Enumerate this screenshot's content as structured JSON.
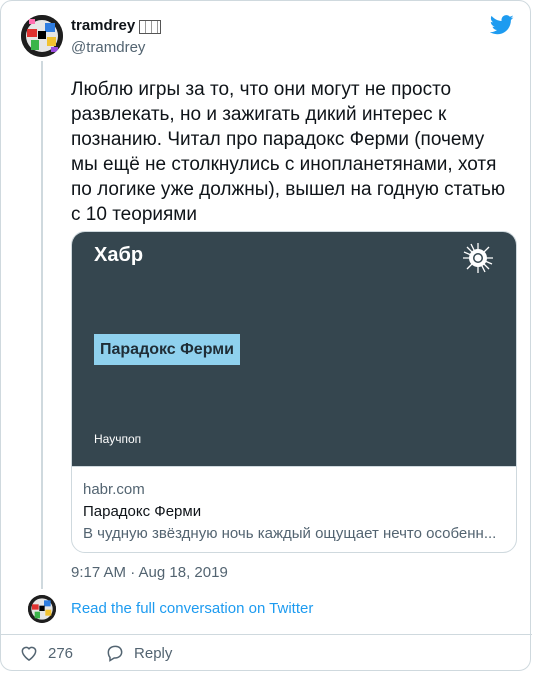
{
  "author": {
    "display_name": "tramdrey",
    "handle": "@tramdrey",
    "avatar_icon": "avatar-colorful-glitch"
  },
  "brand_icon": "twitter-bird-icon",
  "tweet": {
    "text": "Люблю игры за то, что они могут не просто развлекать, но и зажигать дикий интерес к познанию. Читал про парадокс Ферми (почему мы ещё не столкнулись с инопланетянами, хотя по логике уже должны), вышел на годную статью с 10 теориями",
    "timestamp": "9:17 AM · Aug 18, 2019"
  },
  "link_card": {
    "preview": {
      "site_logo": "Хабр",
      "headline_chip": "Парадокс Ферми",
      "category": "Научпоп",
      "background_color": "#35464f",
      "chip_color": "#8fd1ee"
    },
    "domain": "habr.com",
    "title": "Парадокс Ферми",
    "description": "В чудную звёздную ночь каждый ощущает нечто особенн..."
  },
  "conversation_link": "Read the full conversation on Twitter",
  "actions": {
    "likes_count": "276",
    "reply_label": "Reply"
  },
  "colors": {
    "accent": "#1d9bf0",
    "secondary_text": "#536471",
    "border": "#cfd9de"
  }
}
